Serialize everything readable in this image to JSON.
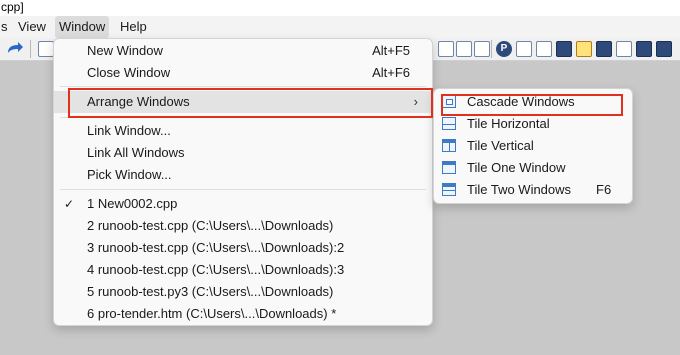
{
  "titlebar": {
    "text": "cpp]"
  },
  "menubar": {
    "items": [
      {
        "label": "s"
      },
      {
        "label": "View"
      },
      {
        "label": "Window"
      },
      {
        "label": "Help"
      }
    ]
  },
  "window_menu": {
    "new_window": {
      "label": "New Window",
      "shortcut": "Alt+F5"
    },
    "close_window": {
      "label": "Close Window",
      "shortcut": "Alt+F6"
    },
    "arrange_windows": {
      "label": "Arrange Windows",
      "arrow": "›"
    },
    "link_window": {
      "label": "Link Window..."
    },
    "link_all_windows": {
      "label": "Link All Windows"
    },
    "pick_window": {
      "label": "Pick Window..."
    },
    "open_windows": [
      {
        "label": "1  New0002.cpp",
        "checked": true,
        "check": "✓"
      },
      {
        "label": "2  runoob-test.cpp (C:\\Users\\...\\Downloads)"
      },
      {
        "label": "3  runoob-test.cpp (C:\\Users\\...\\Downloads):2"
      },
      {
        "label": "4  runoob-test.cpp (C:\\Users\\...\\Downloads):3"
      },
      {
        "label": "5  runoob-test.py3 (C:\\Users\\...\\Downloads)"
      },
      {
        "label": "6  pro-tender.htm (C:\\Users\\...\\Downloads) *"
      }
    ]
  },
  "arrange_submenu": {
    "items": [
      {
        "label": "Cascade Windows",
        "icon": "cascade-windows-icon"
      },
      {
        "label": "Tile Horizontal",
        "icon": "tile-horizontal-icon"
      },
      {
        "label": "Tile Vertical",
        "icon": "tile-vertical-icon"
      },
      {
        "label": "Tile One Window",
        "icon": "tile-one-window-icon"
      },
      {
        "label": "Tile Two Windows",
        "icon": "tile-two-windows-icon",
        "shortcut": "F6"
      }
    ]
  },
  "colors": {
    "highlight_box": "#e0301e",
    "icon_blue": "#3f7bc4",
    "menu_bg": "#f9f9f9",
    "workspace_bg": "#c8c8c8"
  }
}
